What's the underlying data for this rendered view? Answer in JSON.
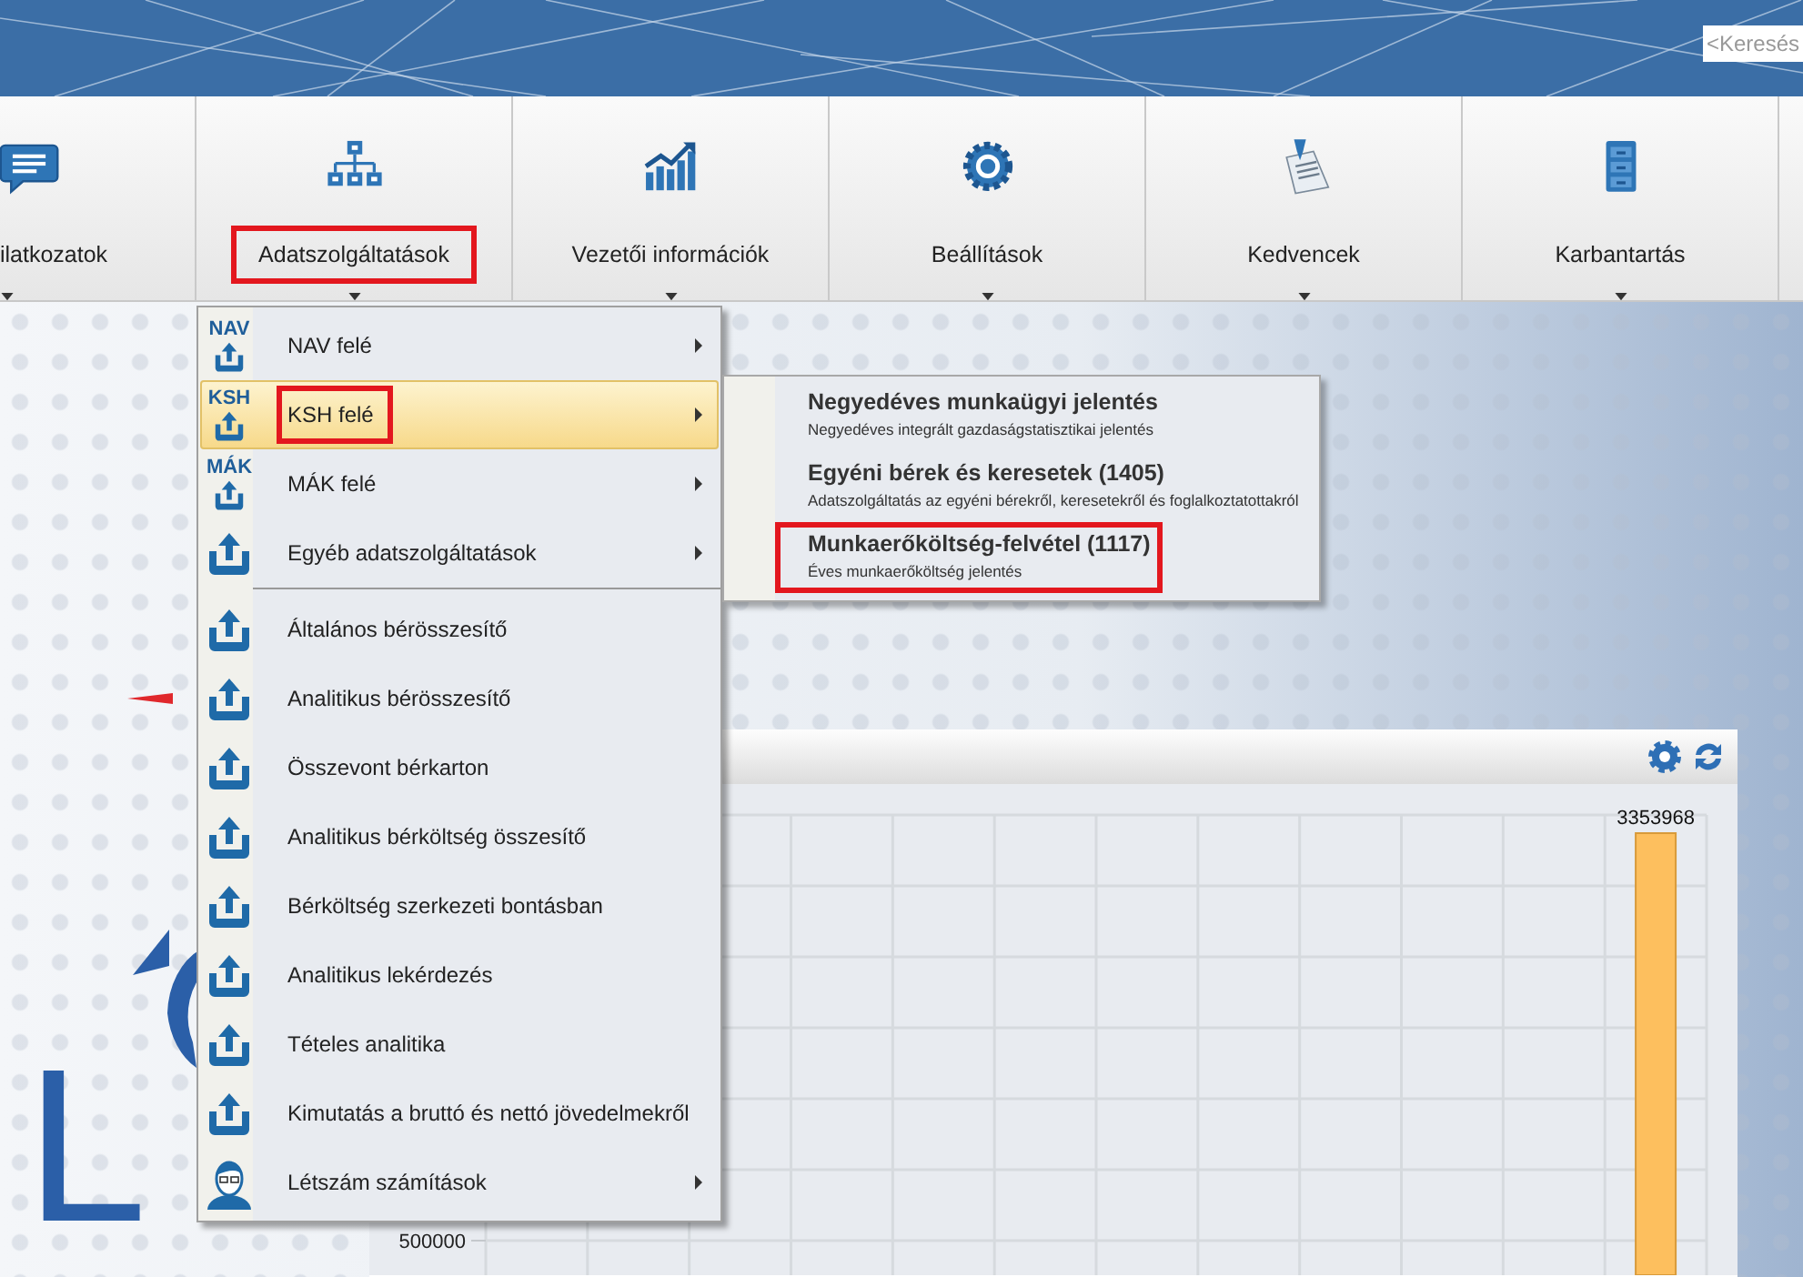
{
  "search": {
    "placeholder": "<Keresés"
  },
  "ribbon_tabs": [
    {
      "label": "ilatkozatok",
      "highlighted": false
    },
    {
      "label": "Adatszolgáltatások",
      "highlighted": true
    },
    {
      "label": "Vezetői információk",
      "highlighted": false
    },
    {
      "label": "Beállítások",
      "highlighted": false
    },
    {
      "label": "Kedvencek",
      "highlighted": false
    },
    {
      "label": "Karbantartás",
      "highlighted": false
    }
  ],
  "logo": "L",
  "menu": {
    "groups": [
      [
        {
          "kind": "upload",
          "icon_label": "NAV",
          "label": "NAV felé",
          "has_submenu": true,
          "selected": false,
          "highlighted": false
        },
        {
          "kind": "upload",
          "icon_label": "KSH",
          "label": "KSH felé",
          "has_submenu": true,
          "selected": true,
          "highlighted": true
        },
        {
          "kind": "upload",
          "icon_label": "MÁK",
          "label": "MÁK felé",
          "has_submenu": true,
          "selected": false,
          "highlighted": false
        },
        {
          "kind": "upload",
          "label": "Egyéb adatszolgáltatások",
          "has_submenu": true,
          "selected": false,
          "highlighted": false
        }
      ],
      [
        {
          "kind": "upload",
          "label": "Általános bérösszesítő",
          "has_submenu": false,
          "selected": false,
          "highlighted": false
        },
        {
          "kind": "upload",
          "label": "Analitikus bérösszesítő",
          "has_submenu": false,
          "selected": false,
          "highlighted": false
        },
        {
          "kind": "upload",
          "label": "Összevont bérkarton",
          "has_submenu": false,
          "selected": false,
          "highlighted": false
        },
        {
          "kind": "upload",
          "label": "Analitikus bérköltség összesítő",
          "has_submenu": false,
          "selected": false,
          "highlighted": false
        },
        {
          "kind": "upload",
          "label": "Bérköltség szerkezeti bontásban",
          "has_submenu": false,
          "selected": false,
          "highlighted": false
        },
        {
          "kind": "upload",
          "label": "Analitikus lekérdezés",
          "has_submenu": false,
          "selected": false,
          "highlighted": false
        },
        {
          "kind": "upload",
          "label": "Tételes analitika",
          "has_submenu": false,
          "selected": false,
          "highlighted": false
        },
        {
          "kind": "upload",
          "label": "Kimutatás a bruttó és nettó jövedelmekről",
          "has_submenu": false,
          "selected": false,
          "highlighted": false
        },
        {
          "kind": "person",
          "label": "Létszám számítások",
          "has_submenu": true,
          "selected": false,
          "highlighted": false
        }
      ]
    ]
  },
  "submenu": [
    {
      "title": "Negyedéves munkaügyi jelentés",
      "description": "Negyedéves integrált gazdaságstatisztikai jelentés",
      "highlighted": false
    },
    {
      "title": "Egyéni bérek és keresetek (1405)",
      "description": "Adatszolgáltatás az egyéni bérekről, keresetekről és foglalkoztatottakról",
      "highlighted": false
    },
    {
      "title": "Munkaerőköltség-felvétel (1117)",
      "description": "Éves munkaerőköltség jelentés",
      "highlighted": true
    }
  ],
  "chart_panel": {
    "axis_label": "500000",
    "bar_label": "3353968"
  }
}
